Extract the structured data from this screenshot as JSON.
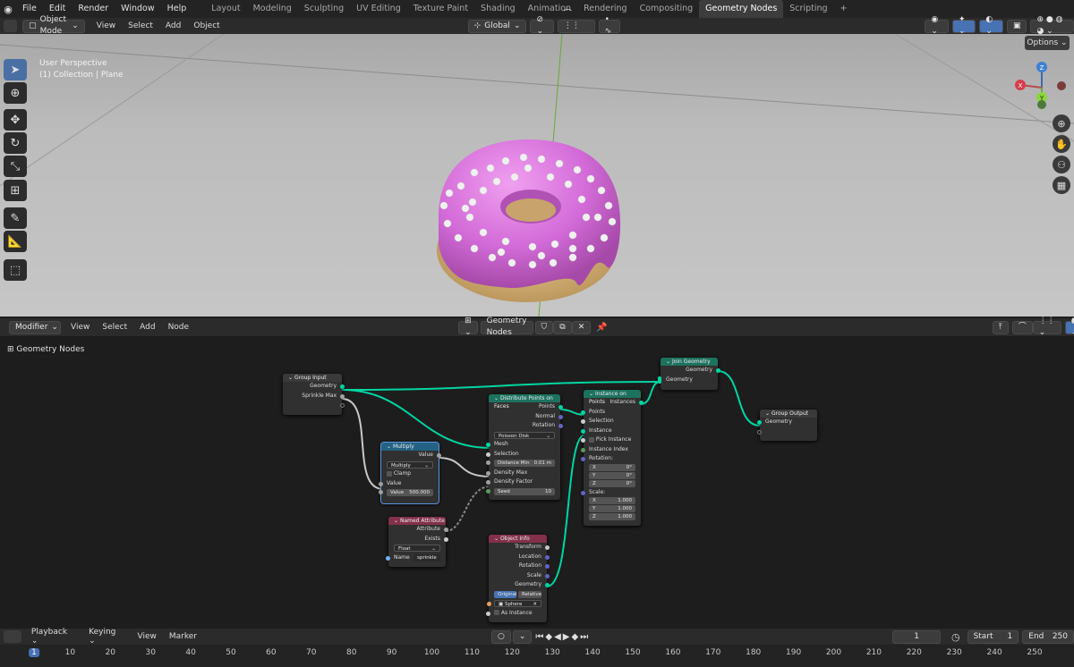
{
  "app": {
    "logo": "blender-icon"
  },
  "topbar": {
    "menus": [
      "File",
      "Edit",
      "Render",
      "Window",
      "Help"
    ],
    "tabs": [
      "Layout",
      "Modeling",
      "Sculpting",
      "UV Editing",
      "Texture Paint",
      "Shading",
      "Animation",
      "Rendering",
      "Compositing",
      "Geometry Nodes",
      "Scripting"
    ],
    "active_tab": "Geometry Nodes",
    "add_tab": "+"
  },
  "viewport_header": {
    "mode": "Object Mode",
    "menus": [
      "View",
      "Select",
      "Add",
      "Object"
    ],
    "orientation": "Global",
    "options": "Options"
  },
  "viewport": {
    "perspective": "User Perspective",
    "collection": "(1) Collection | Plane",
    "gizmo": {
      "z": "Z",
      "x": "X",
      "y": "Y"
    }
  },
  "node_header": {
    "editor_type": "Modifier",
    "menus": [
      "View",
      "Select",
      "Add",
      "Node"
    ],
    "tree": "Geometry Nodes"
  },
  "breadcrumb": "Geometry Nodes",
  "nodes": {
    "group_input": {
      "title": "Group Input",
      "outputs": [
        "Geometry",
        "Sprinkle Max"
      ]
    },
    "multiply": {
      "title": "Multiply",
      "output": "Value",
      "op": "Multiply",
      "clamp": "Clamp",
      "input": "Value",
      "value_label": "Value",
      "value": "500.000"
    },
    "named_attr": {
      "title": "Named Attribute",
      "outputs": [
        "Attribute",
        "Exists"
      ],
      "type": "Float",
      "name_label": "Name",
      "name_value": "sprinkle"
    },
    "distribute": {
      "title": "Distribute Points on Faces",
      "outputs": [
        "Points",
        "Normal",
        "Rotation"
      ],
      "method": "Poisson Disk",
      "inputs": [
        "Mesh",
        "Selection"
      ],
      "dist_label": "Distance Min",
      "dist_value": "0.01 m",
      "inputs2": [
        "Density Max",
        "Density Factor"
      ],
      "seed_label": "Seed",
      "seed_value": "10"
    },
    "object_info": {
      "title": "Object Info",
      "outputs": [
        "Transform",
        "Location",
        "Rotation",
        "Scale",
        "Geometry"
      ],
      "mode_original": "Original",
      "mode_relative": "Relative",
      "object": "Sphere",
      "as_instance": "As Instance"
    },
    "instance": {
      "title": "Instance on Points",
      "output": "Instances",
      "inputs": [
        "Points",
        "Selection",
        "Instance"
      ],
      "pick": "Pick Instance",
      "index": "Instance Index",
      "rotation": "Rotation:",
      "rot": [
        {
          "k": "X",
          "v": "0°"
        },
        {
          "k": "Y",
          "v": "0°"
        },
        {
          "k": "Z",
          "v": "0°"
        }
      ],
      "scale": "Scale:",
      "scl": [
        {
          "k": "X",
          "v": "1.000"
        },
        {
          "k": "Y",
          "v": "1.000"
        },
        {
          "k": "Z",
          "v": "1.000"
        }
      ]
    },
    "join": {
      "title": "Join Geometry",
      "output": "Geometry",
      "input": "Geometry"
    },
    "group_output": {
      "title": "Group Output",
      "input": "Geometry"
    }
  },
  "timeline": {
    "menus": [
      "Playback",
      "Keying",
      "View",
      "Marker"
    ],
    "current_frame": "1",
    "start_label": "Start",
    "start": "1",
    "end_label": "End",
    "end": "250",
    "ticks": [
      "1",
      "10",
      "20",
      "30",
      "40",
      "50",
      "60",
      "70",
      "80",
      "90",
      "100",
      "110",
      "120",
      "130",
      "140",
      "150",
      "160",
      "170",
      "180",
      "190",
      "200",
      "210",
      "220",
      "230",
      "240",
      "250"
    ]
  },
  "colors": {
    "accent": "#4772b3",
    "geometry_socket": "#00d6a3",
    "float_socket": "#a1a1a1",
    "vector_socket": "#6363c7",
    "header_attr": "#83314a",
    "header_geo": "#1d725e",
    "header_util": "#246283"
  }
}
